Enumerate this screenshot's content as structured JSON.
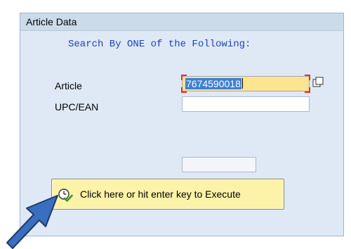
{
  "group": {
    "title": "Article Data"
  },
  "instruction": "Search By ONE of the Following:",
  "fields": [
    {
      "label": "Article",
      "value": "7674590018"
    },
    {
      "label": "UPC/EAN",
      "value": ""
    },
    {
      "label": "",
      "value": ""
    }
  ],
  "execute_button": {
    "label": "Click here or hit enter key to Execute",
    "icon": "execute-clock-check-icon"
  },
  "annotation": {
    "icon": "arrow-pointer-icon"
  },
  "colors": {
    "panel_bg": "#dfe9f5",
    "header_bg": "#ccdbea",
    "instruction_text": "#1f3fbf",
    "active_field": "#fde48f",
    "selection": "#3f7fd2",
    "button_bg": "#fdf3a8",
    "arrow": "#3a6fbf"
  }
}
